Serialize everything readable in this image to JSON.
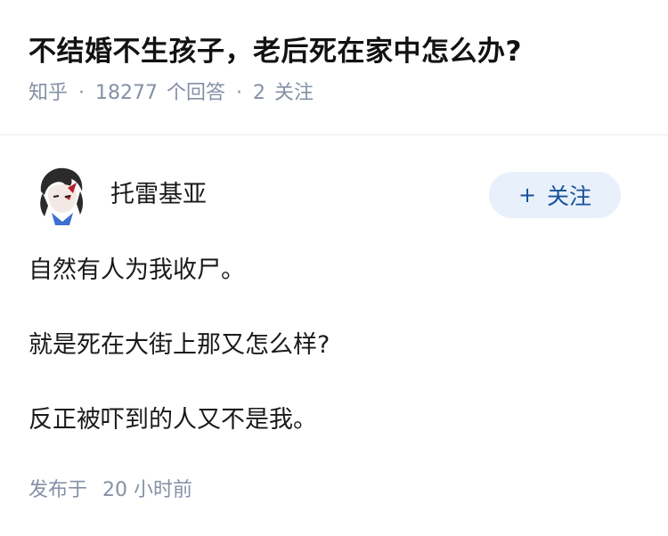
{
  "question": {
    "title": "不结婚不生孩子，老后死在家中怎么办?",
    "source": "知乎",
    "separator": "·",
    "answer_count": "18277",
    "answer_label": "个回答",
    "follow_count": "2",
    "follow_label": "关注"
  },
  "author": {
    "name": "托雷基亚",
    "follow_button_label": "关注",
    "follow_button_plus": "+"
  },
  "answer": {
    "paragraphs": [
      "自然有人为我收尸。",
      "就是死在大街上那又怎么样?",
      "反正被吓到的人又不是我。"
    ]
  },
  "footer": {
    "published_label": "发布于",
    "published_time": "20 小时前"
  },
  "colors": {
    "meta_gray": "#8590a6",
    "follow_bg": "#e8f0fb",
    "follow_text": "#175199"
  },
  "icons": {
    "avatar": "avatar-anime-portrait"
  }
}
